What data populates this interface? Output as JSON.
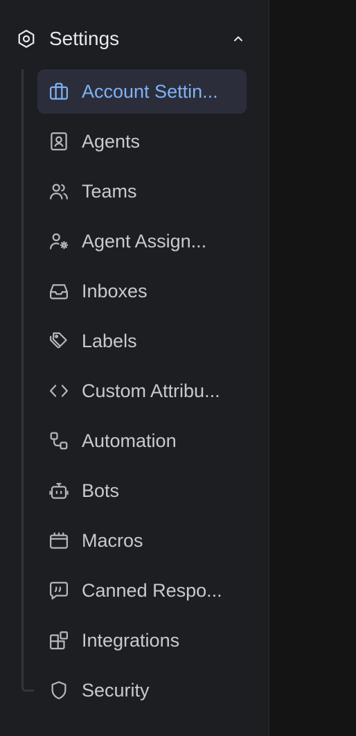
{
  "colors": {
    "sidebar_bg": "#1d1e22",
    "active_bg": "#2b2e3a",
    "accent": "#7fb2f5",
    "text": "#c9cacf",
    "heading": "#e7e8ec"
  },
  "sidebar": {
    "section_title": "Settings",
    "section_icon": "hexagon-gear-icon",
    "expanded": true,
    "items": [
      {
        "label": "Account Settin...",
        "icon": "briefcase-icon",
        "active": true
      },
      {
        "label": "Agents",
        "icon": "contact-card-icon"
      },
      {
        "label": "Teams",
        "icon": "users-icon"
      },
      {
        "label": "Agent Assign...",
        "icon": "user-settings-icon"
      },
      {
        "label": "Inboxes",
        "icon": "inbox-icon"
      },
      {
        "label": "Labels",
        "icon": "tag-icon"
      },
      {
        "label": "Custom Attribu...",
        "icon": "code-icon"
      },
      {
        "label": "Automation",
        "icon": "workflow-icon"
      },
      {
        "label": "Bots",
        "icon": "bot-icon"
      },
      {
        "label": "Macros",
        "icon": "macros-icon"
      },
      {
        "label": "Canned Respo...",
        "icon": "quote-message-icon"
      },
      {
        "label": "Integrations",
        "icon": "blocks-icon"
      },
      {
        "label": "Security",
        "icon": "shield-icon"
      }
    ]
  }
}
